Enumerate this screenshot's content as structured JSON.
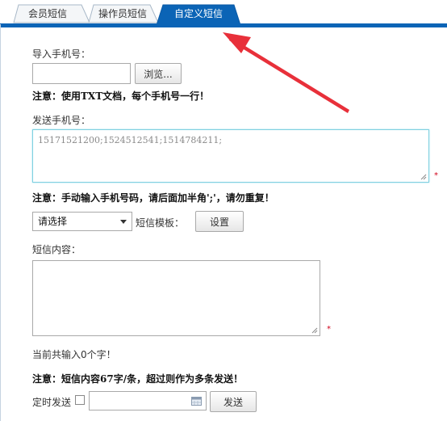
{
  "tabs": [
    {
      "label": "会员短信",
      "active": false
    },
    {
      "label": "操作员短信",
      "active": false
    },
    {
      "label": "自定义短信",
      "active": true
    }
  ],
  "import": {
    "label": "导入手机号：",
    "browse_label": "浏览...",
    "note": "注意：使用TXT文档，每个手机号一行！"
  },
  "send": {
    "label": "发送手机号：",
    "numbers": "15171521200;1524512541;1514784211;",
    "required_mark": "*",
    "note": "注意：手动输入手机号码，请后面加半角';'，请勿重复！"
  },
  "template": {
    "selected": "请选择",
    "label": "短信模板：",
    "setup_label": "设置"
  },
  "content": {
    "label": "短信内容：",
    "value": "",
    "required_mark": "*",
    "count_text": "当前共输入0个字！",
    "note": "注意：短信内容67字/条，超过则作为多条发送！"
  },
  "schedule": {
    "label": "定时发送",
    "date_value": "",
    "send_label": "发送"
  },
  "colors": {
    "active_tab": "#0b64b6",
    "arrow": "#e8303a",
    "panel_border": "#c6d3e0"
  }
}
